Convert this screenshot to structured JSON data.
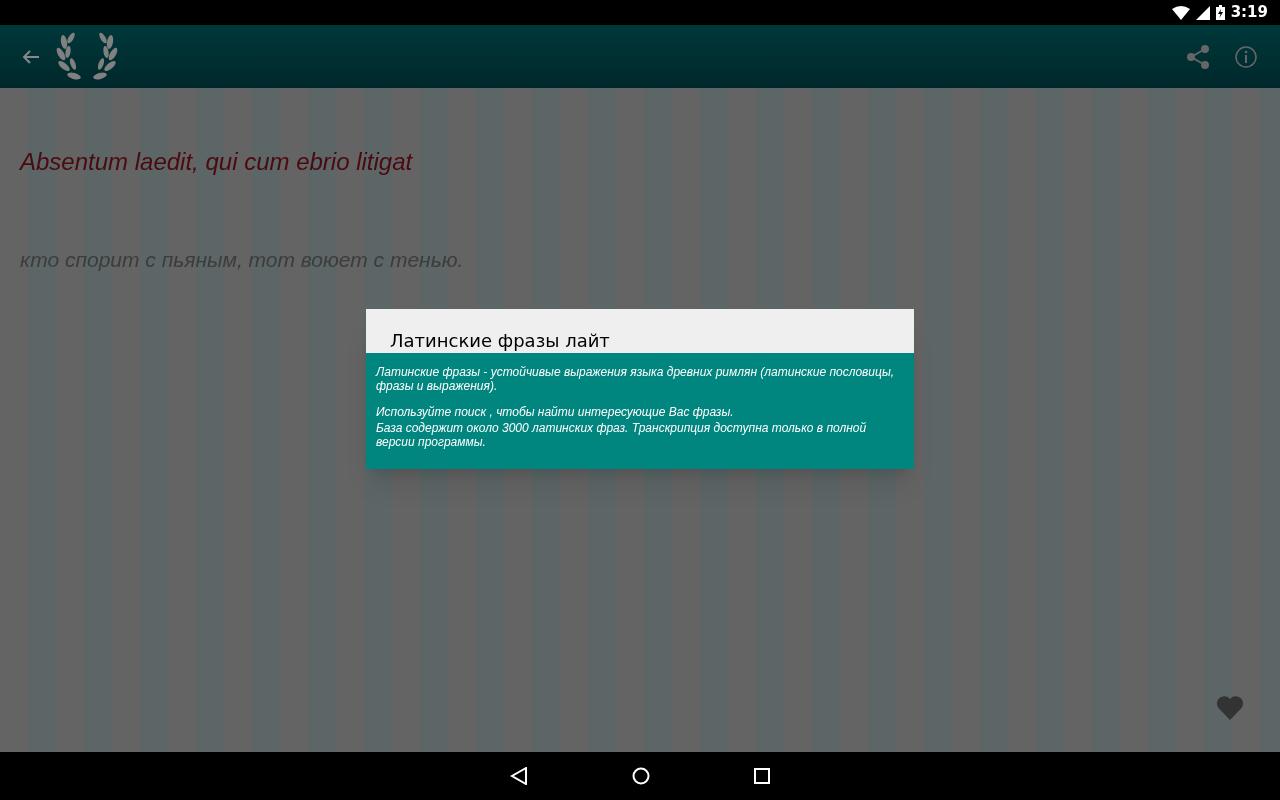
{
  "status_bar": {
    "time": "3:19"
  },
  "phrase": {
    "latin": "Absentum laedit, qui cum ebrio litigat",
    "translation": "кто спорит с пьяным, тот воюет с тенью."
  },
  "dialog": {
    "title": "Латинские фразы лайт",
    "paragraphs": [
      "Латинские фразы - устойчивые выражения языка древних римлян (латинские пословицы, фразы и выражения).",
      "Используйте поиск , чтобы найти интересующие Вас фразы.",
      "База содержит около 3000 латинских фраз. Транскрипция доступна только в полной версии программы."
    ]
  }
}
